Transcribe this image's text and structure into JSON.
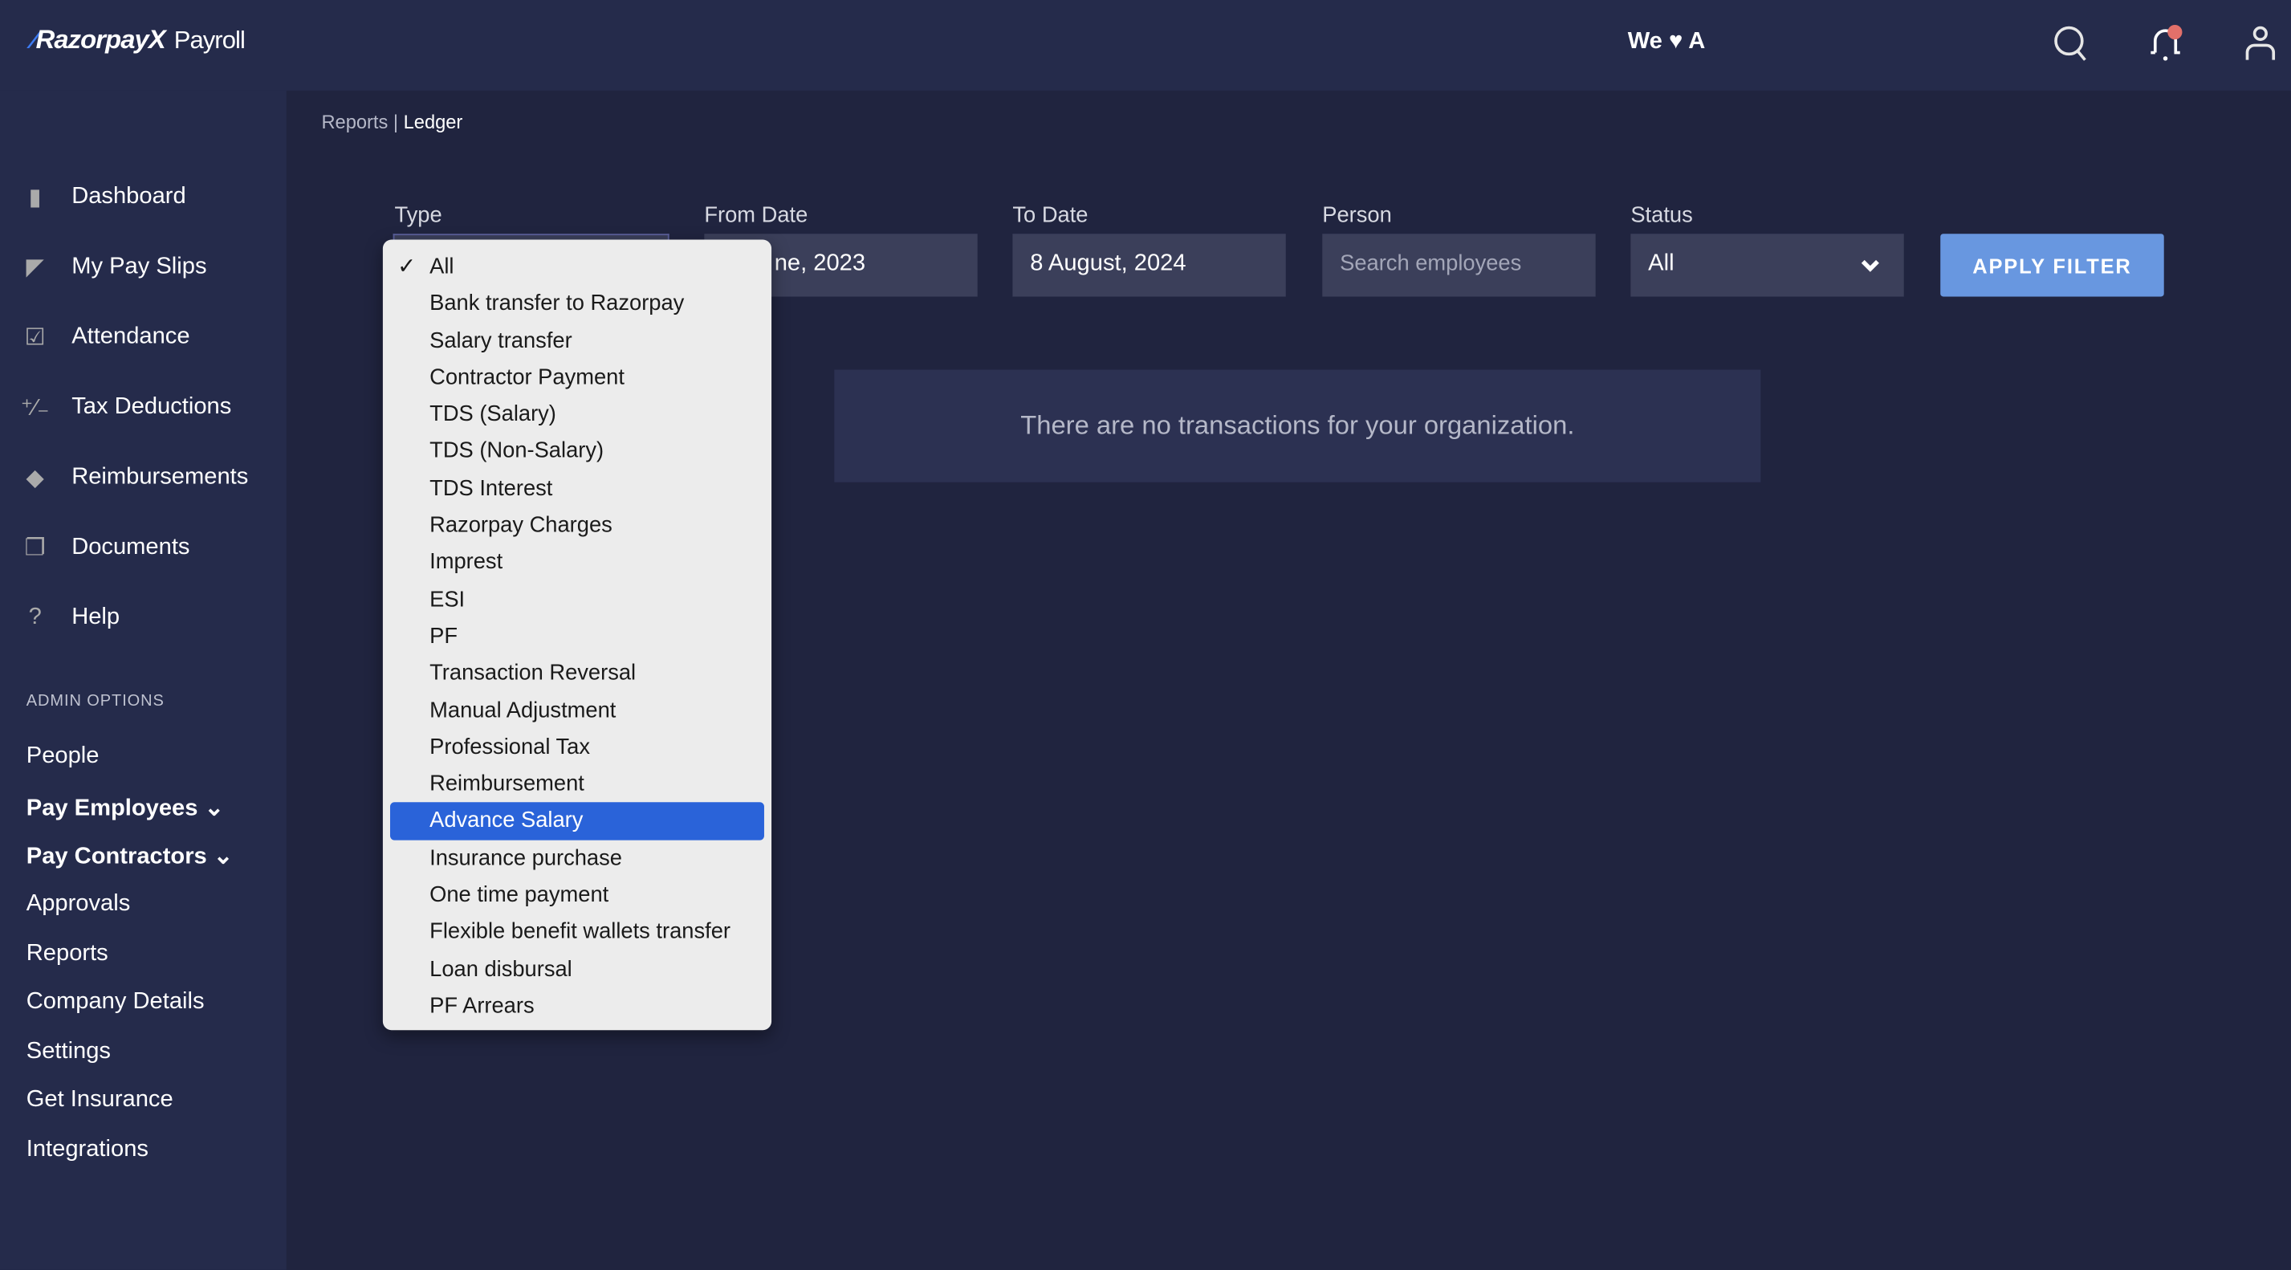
{
  "header": {
    "brand": "RazorpayX",
    "product": "Payroll",
    "tagline": "We ♥ A",
    "icons": [
      "search-icon",
      "bell-icon",
      "user-icon"
    ],
    "notification_color": "#e2706a"
  },
  "sidebar": {
    "items": [
      {
        "label": "Dashboard",
        "icon": "clipboard-icon"
      },
      {
        "label": "My Pay Slips",
        "icon": "paper-plane-icon"
      },
      {
        "label": "Attendance",
        "icon": "calendar-check-icon"
      },
      {
        "label": "Tax Deductions",
        "icon": "percent-icon"
      },
      {
        "label": "Reimbursements",
        "icon": "tag-icon"
      },
      {
        "label": "Documents",
        "icon": "documents-icon"
      },
      {
        "label": "Help",
        "icon": "question-icon"
      }
    ],
    "admin_title": "ADMIN OPTIONS",
    "admin_items": [
      {
        "label": "People"
      },
      {
        "label": "Pay Employees"
      },
      {
        "label": "Pay Contractors"
      },
      {
        "label": "Approvals"
      },
      {
        "label": "Reports"
      },
      {
        "label": "Company Details"
      },
      {
        "label": "Settings"
      },
      {
        "label": "Get Insurance"
      },
      {
        "label": "Integrations"
      }
    ]
  },
  "breadcrumb": {
    "parent": "Reports",
    "separator": " | ",
    "current": "Ledger"
  },
  "filters": {
    "type_label": "Type",
    "from_label": "From Date",
    "from_value": "ne, 2023",
    "to_label": "To Date",
    "to_value": "8 August, 2024",
    "person_label": "Person",
    "person_placeholder": "Search employees",
    "status_label": "Status",
    "status_value": "All",
    "apply": "APPLY FILTER"
  },
  "empty_message": "There are no transactions for your organization.",
  "type_options": [
    "All",
    "Bank transfer to Razorpay",
    "Salary transfer",
    "Contractor Payment",
    "TDS (Salary)",
    "TDS (Non-Salary)",
    "TDS Interest",
    "Razorpay Charges",
    "Imprest",
    "ESI",
    "PF",
    "Transaction Reversal",
    "Manual Adjustment",
    "Professional Tax",
    "Reimbursement",
    "Advance Salary",
    "Insurance purchase",
    "One time payment",
    "Flexible benefit wallets transfer",
    "Loan disbursal",
    "PF Arrears"
  ],
  "type_checked": "All",
  "type_highlighted": "Advance Salary",
  "colors": {
    "accent": "#6897e0",
    "highlight": "#2a63d9"
  }
}
